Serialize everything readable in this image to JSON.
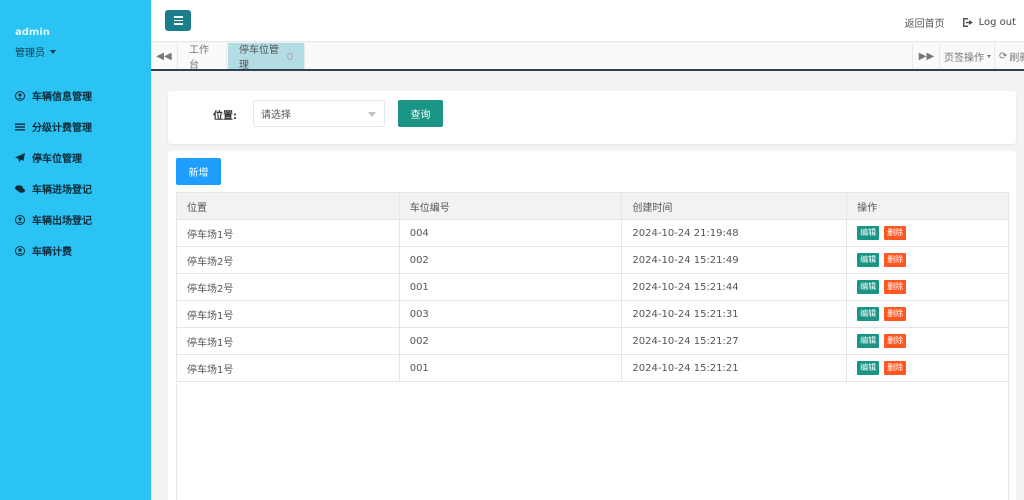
{
  "sidebar": {
    "user_name": "admin",
    "user_role": "管理员",
    "items": [
      {
        "label": "车辆信息管理",
        "icon": "user-circle-icon"
      },
      {
        "label": "分级计费管理",
        "icon": "list-icon"
      },
      {
        "label": "停车位管理",
        "icon": "paper-plane-icon"
      },
      {
        "label": "车辆进场登记",
        "icon": "comments-icon"
      },
      {
        "label": "车辆出场登记",
        "icon": "user-circle-icon"
      },
      {
        "label": "车辆计费",
        "icon": "user-circle-icon"
      }
    ]
  },
  "header": {
    "home_link": "返回首页",
    "logout_label": "Log out"
  },
  "tabs": {
    "home": "工作台",
    "active": "停车位管理",
    "ops_label": "页签操作",
    "refresh_label": "刷新"
  },
  "search": {
    "label": "位置:",
    "placeholder": "请选择",
    "query_button": "查询"
  },
  "table": {
    "add_button": "新增",
    "columns": [
      "位置",
      "车位编号",
      "创建时间",
      "操作"
    ],
    "edit_label": "编辑",
    "delete_label": "删除",
    "rows": [
      {
        "location": "停车场1号",
        "space_no": "004",
        "created": "2024-10-24 21:19:48"
      },
      {
        "location": "停车场2号",
        "space_no": "002",
        "created": "2024-10-24 15:21:49"
      },
      {
        "location": "停车场2号",
        "space_no": "001",
        "created": "2024-10-24 15:21:44"
      },
      {
        "location": "停车场1号",
        "space_no": "003",
        "created": "2024-10-24 15:21:31"
      },
      {
        "location": "停车场1号",
        "space_no": "002",
        "created": "2024-10-24 15:21:27"
      },
      {
        "location": "停车场1号",
        "space_no": "001",
        "created": "2024-10-24 15:21:21"
      }
    ]
  },
  "colors": {
    "sidebar_bg": "#2bc3f3",
    "primary_teal": "#1a9484",
    "add_blue": "#1e9fff",
    "delete_orange": "#ff5722",
    "active_tab": "#b3dce5"
  }
}
